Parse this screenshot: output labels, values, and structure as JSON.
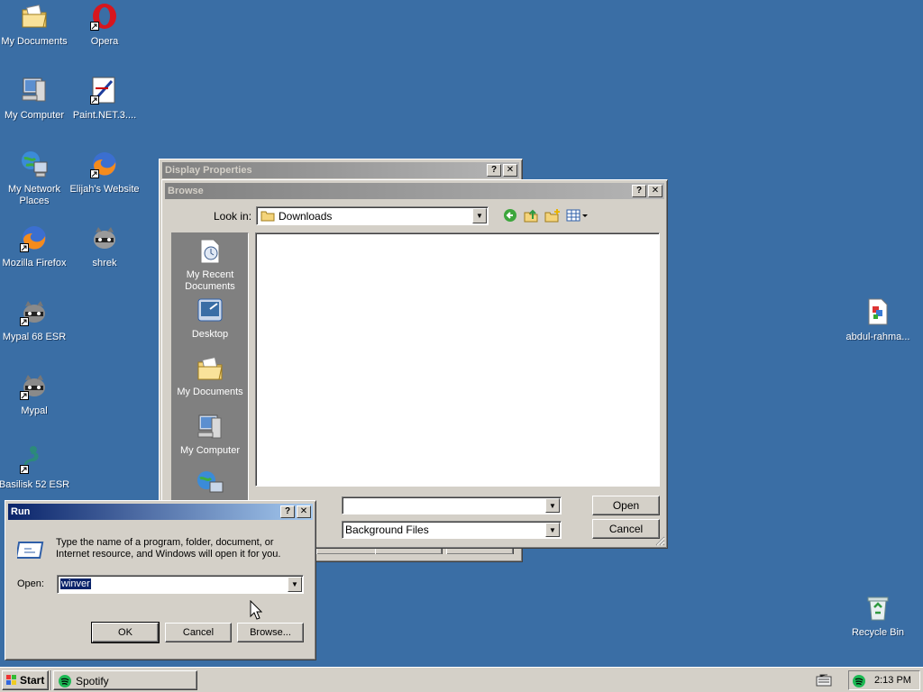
{
  "desktop": {
    "background_color": "#3a6ea5",
    "icons": [
      {
        "label": "My Documents",
        "icon": "folder-documents-icon"
      },
      {
        "label": "Opera",
        "icon": "opera-icon"
      },
      {
        "label": "My Computer",
        "icon": "computer-icon"
      },
      {
        "label": "Paint.NET.3....",
        "icon": "paintnet-icon"
      },
      {
        "label": "My Network Places",
        "icon": "network-icon"
      },
      {
        "label": "Elijah's Website",
        "icon": "firefox-icon"
      },
      {
        "label": "Mozilla Firefox",
        "icon": "firefox-icon"
      },
      {
        "label": "shrek",
        "icon": "raccoon-icon"
      },
      {
        "label": "Mypal 68 ESR",
        "icon": "raccoon-icon"
      },
      {
        "label": "Mypal",
        "icon": "raccoon-icon"
      },
      {
        "label": "Basilisk 52 ESR",
        "icon": "basilisk-icon"
      },
      {
        "label": "abdul-rahma...",
        "icon": "document-icon"
      },
      {
        "label": "Recycle Bin",
        "icon": "recycle-bin-icon"
      }
    ]
  },
  "display_properties": {
    "title": "Display Properties",
    "help": "?",
    "close": "✕"
  },
  "browse": {
    "title": "Browse",
    "help": "?",
    "close": "✕",
    "look_in_label": "Look in:",
    "look_in_value": "Downloads",
    "places": [
      {
        "label": "My Recent Documents",
        "icon": "recent-documents-icon"
      },
      {
        "label": "Desktop",
        "icon": "desktop-icon"
      },
      {
        "label": "My Documents",
        "icon": "folder-documents-icon"
      },
      {
        "label": "My Computer",
        "icon": "computer-icon"
      },
      {
        "label": "",
        "icon": "network-icon"
      }
    ],
    "filename_value": "",
    "filetype_value": "Background Files",
    "open_button": "Open",
    "cancel_button": "Cancel"
  },
  "run": {
    "title": "Run",
    "help": "?",
    "close": "✕",
    "description": "Type the name of a program, folder, document, or Internet resource, and Windows will open it for you.",
    "open_label": "Open:",
    "open_value": "winver",
    "ok_button": "OK",
    "cancel_button": "Cancel",
    "browse_button": "Browse..."
  },
  "taskbar": {
    "start_label": "Start",
    "tasks": [
      {
        "label": "Spotify",
        "icon": "spotify-icon"
      }
    ],
    "tray_icons": [
      "keyboard-icon",
      "spotify-icon"
    ],
    "clock": "2:13 PM"
  },
  "colors": {
    "active_title_start": "#0a246a",
    "active_title_end": "#a6caf0",
    "inactive_title_start": "#808080",
    "inactive_title_end": "#b5b5b5",
    "face": "#d4d0c8"
  }
}
